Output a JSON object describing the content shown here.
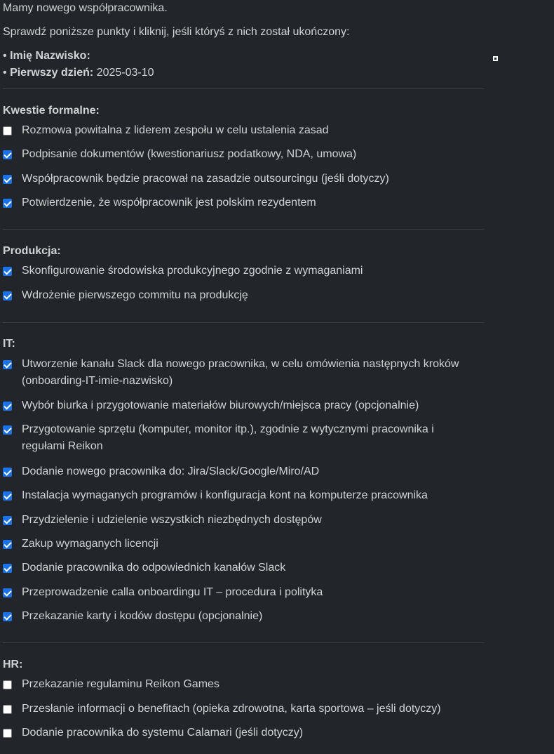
{
  "intro": {
    "greeting": "Mamy nowego współpracownika.",
    "instruction": "Sprawdź poniższe punkty i kliknij, jeśli któryś z nich został ukończony:",
    "name_label": "Imię Nazwisko:",
    "first_day_label": "Pierwszy dzień:",
    "first_day_value": "2025-03-10",
    "bullet": "•"
  },
  "sections": {
    "formal": {
      "title": "Kwestie formalne:",
      "items": [
        {
          "label": "Rozmowa powitalna z liderem zespołu w celu ustalenia zasad",
          "checked": false
        },
        {
          "label": "Podpisanie dokumentów (kwestionariusz podatkowy, NDA, umowa)",
          "checked": true
        },
        {
          "label": "Współpracownik będzie pracował na zasadzie outsourcingu (jeśli dotyczy)",
          "checked": true
        },
        {
          "label": "Potwierdzenie, że współpracownik jest polskim rezydentem",
          "checked": true
        }
      ]
    },
    "production": {
      "title": "Produkcja:",
      "items": [
        {
          "label": "Skonfigurowanie środowiska produkcyjnego zgodnie z wymaganiami",
          "checked": true
        },
        {
          "label": "Wdrożenie pierwszego commitu na produkcję",
          "checked": true
        }
      ]
    },
    "it": {
      "title": "IT:",
      "items": [
        {
          "label": "Utworzenie kanału Slack dla nowego pracownika, w celu omówienia następnych kroków (onboarding-IT-imie-nazwisko)",
          "checked": true
        },
        {
          "label": "Wybór biurka i przygotowanie materiałów biurowych/miejsca pracy (opcjonalnie)",
          "checked": true
        },
        {
          "label": "Przygotowanie sprzętu (komputer, monitor itp.), zgodnie z wytycznymi pracownika i regułami Reikon",
          "checked": true
        },
        {
          "label": "Dodanie nowego pracownika do: Jira/Slack/Google/Miro/AD",
          "checked": true
        },
        {
          "label": "Instalacja wymaganych programów i konfiguracja kont na komputerze pracownika",
          "checked": true
        },
        {
          "label": "Przydzielenie i udzielenie wszystkich niezbędnych dostępów",
          "checked": true
        },
        {
          "label": "Zakup wymaganych licencji",
          "checked": true
        },
        {
          "label": "Dodanie pracownika do odpowiednich kanałów Slack",
          "checked": true
        },
        {
          "label": "Przeprowadzenie calla onboardingu IT – procedura i polityka",
          "checked": true
        },
        {
          "label": "Przekazanie karty i kodów dostępu (opcjonalnie)",
          "checked": true
        }
      ]
    },
    "hr": {
      "title": "HR:",
      "items": [
        {
          "label": "Przekazanie regulaminu Reikon Games",
          "checked": false
        },
        {
          "label": "Przesłanie informacji o benefitach (opieka zdrowotna, karta sportowa – jeśli dotyczy)",
          "checked": false
        },
        {
          "label": "Dodanie pracownika do systemu Calamari (jeśli dotyczy)",
          "checked": false
        }
      ]
    }
  },
  "colors": {
    "background": "#222529",
    "text": "#d1d2d3",
    "checkbox_checked": "#1a73e8",
    "divider": "#3a3d42"
  }
}
